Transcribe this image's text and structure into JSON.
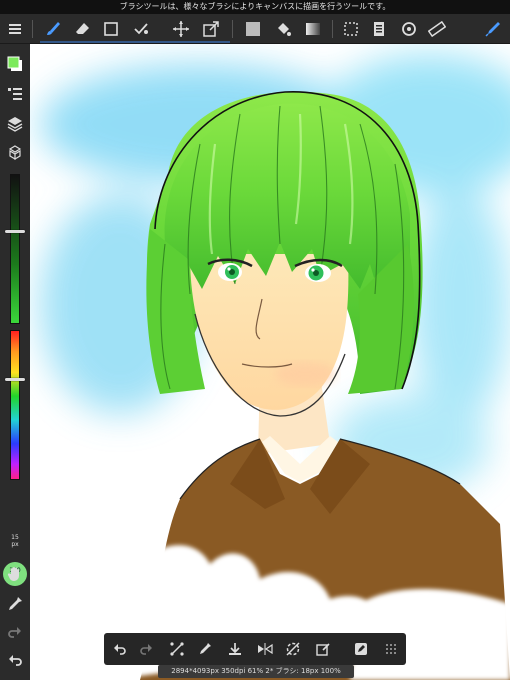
{
  "tip_text": "ブラシツールは、様々なブラシによりキャンバスに描画を行うツールです。",
  "top_toolbar": {
    "tools": [
      "menu-icon",
      "brush-icon",
      "eraser-icon",
      "select-rect-icon",
      "select-check-icon",
      "move-icon",
      "transform-icon",
      "fill-color-icon",
      "bucket-icon",
      "gradient-icon",
      "select-layer-icon",
      "layers-panel-icon",
      "rotate-icon",
      "ruler-icon",
      "pen-icon"
    ]
  },
  "left_toolbar": {
    "brush_size": "15",
    "brush_unit": "px",
    "opacity_value": "100",
    "opacity_unit": "%",
    "brush_size_slider_level": 0.38,
    "opacity_slider_level": 0.45,
    "hue_slider_level": 0.33
  },
  "colors": {
    "foreground": "#7dea5c",
    "toolbar": "#2b2b2b",
    "accent": "#3a7bd5"
  },
  "status_text": "2894*4093px 350dpi 61% 2* ブラシ: 18px 100%"
}
